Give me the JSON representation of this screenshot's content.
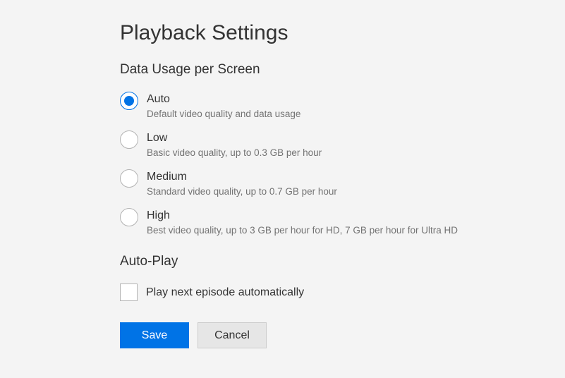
{
  "title": "Playback Settings",
  "sections": {
    "dataUsage": {
      "heading": "Data Usage per Screen",
      "options": [
        {
          "label": "Auto",
          "description": "Default video quality and data usage",
          "selected": true
        },
        {
          "label": "Low",
          "description": "Basic video quality, up to 0.3 GB per hour",
          "selected": false
        },
        {
          "label": "Medium",
          "description": "Standard video quality, up to 0.7 GB per hour",
          "selected": false
        },
        {
          "label": "High",
          "description": "Best video quality, up to 3 GB per hour for HD, 7 GB per hour for Ultra HD",
          "selected": false
        }
      ]
    },
    "autoPlay": {
      "heading": "Auto-Play",
      "checkbox": {
        "label": "Play next episode automatically",
        "checked": false
      }
    }
  },
  "buttons": {
    "save": "Save",
    "cancel": "Cancel"
  }
}
